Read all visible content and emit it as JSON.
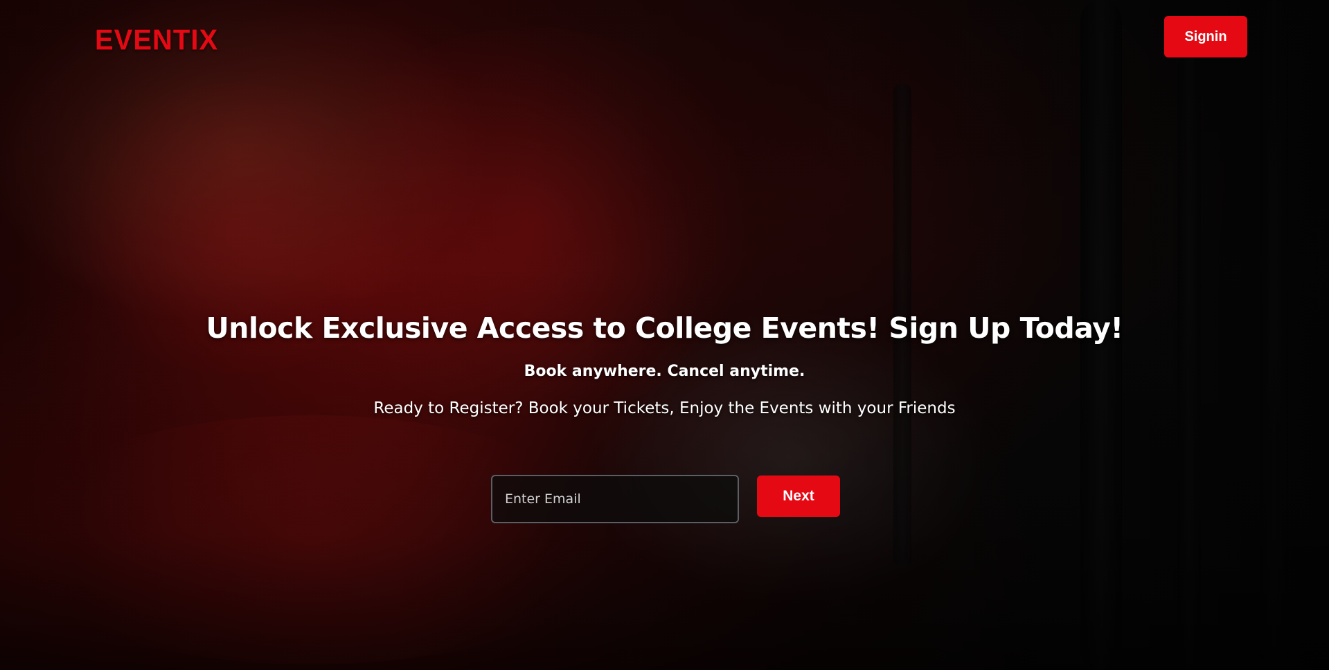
{
  "header": {
    "logo_text": "EVENTIX",
    "signin_label": "Signin"
  },
  "hero": {
    "title": "Unlock Exclusive Access to College Events! Sign Up Today!",
    "tagline": "Book anywhere. Cancel anytime.",
    "subtitle": "Ready to Register? Book your Tickets, Enjoy the Events with your Friends"
  },
  "form": {
    "email_placeholder": "Enter Email",
    "email_value": "",
    "next_label": "Next"
  },
  "colors": {
    "brand": "#e50914",
    "text": "#ffffff",
    "input_border": "#5a5f66"
  }
}
